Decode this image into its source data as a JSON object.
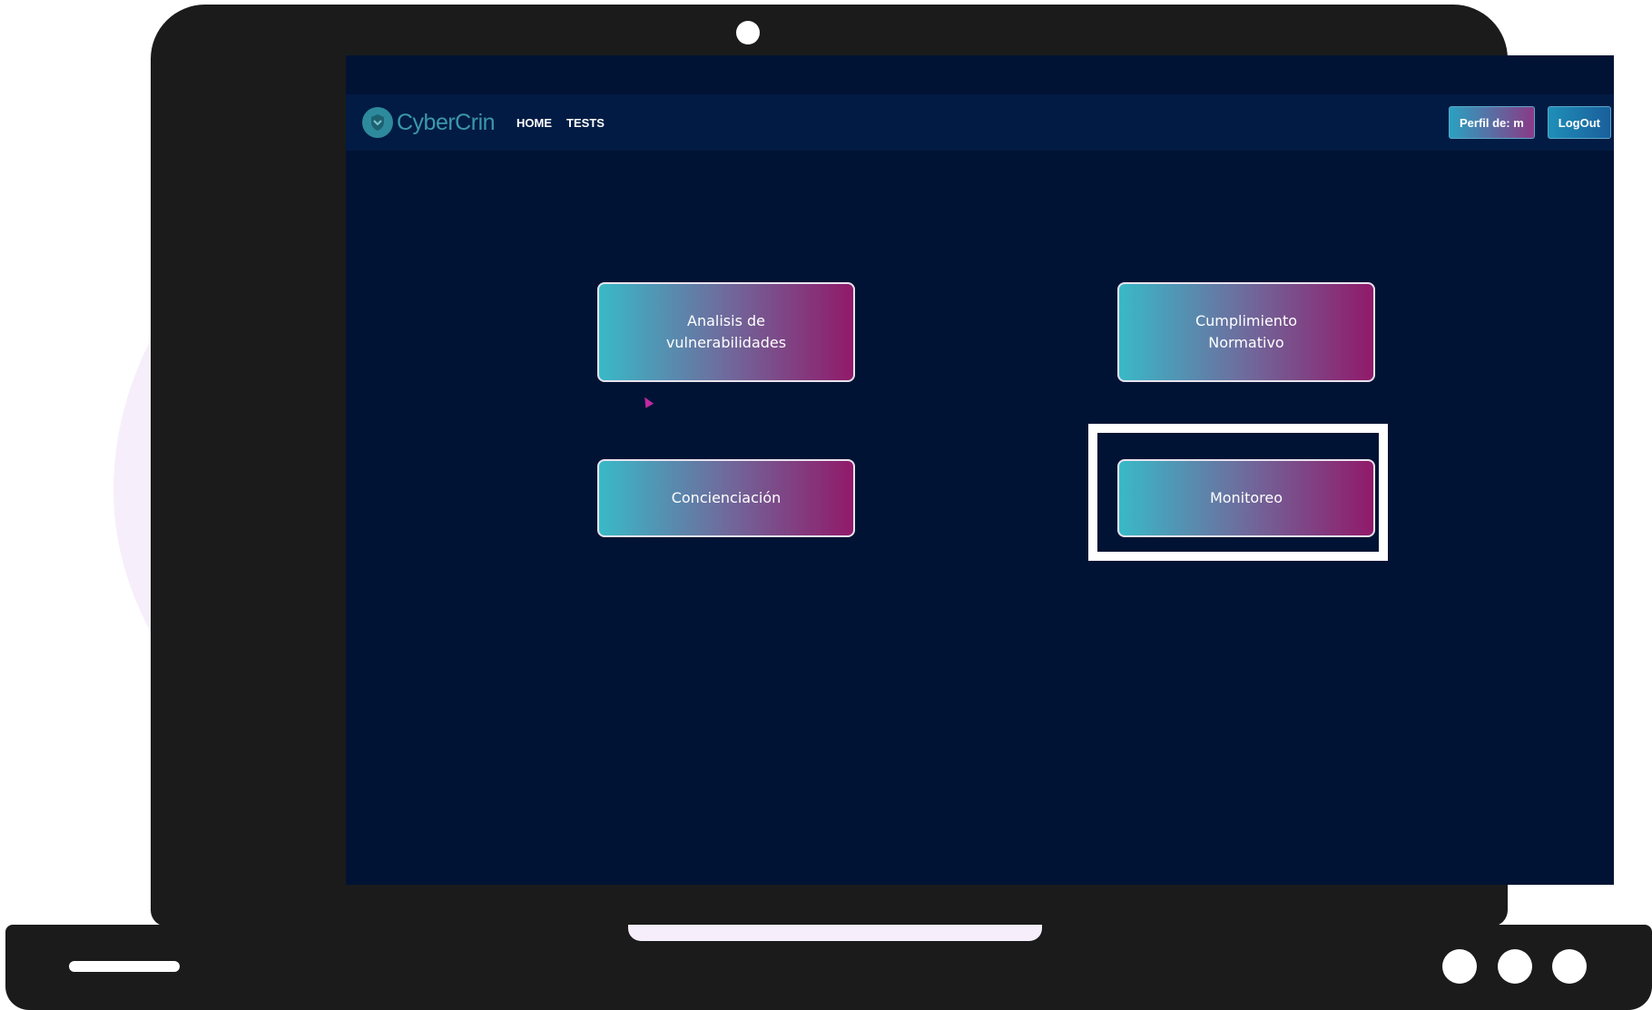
{
  "app": {
    "brand": "CyberCrin"
  },
  "nav": {
    "home": "HOME",
    "tests": "TESTS",
    "profile": "Perfil de: m",
    "logout": "LogOut"
  },
  "cards": [
    {
      "label": "Analisis de vulnerabilidades"
    },
    {
      "label": "Cumplimiento Normativo"
    },
    {
      "label": "Concienciación"
    },
    {
      "label": "Monitoreo"
    }
  ],
  "icons": {
    "logo": "shield-icon",
    "pointer": "cursor-icon"
  },
  "colors": {
    "page_background": "#011334",
    "navbar": "#021b45",
    "brand": "#3b98aa",
    "card_start": "#39b9c7",
    "card_end": "#911a6a",
    "highlight": "#ffffff"
  }
}
